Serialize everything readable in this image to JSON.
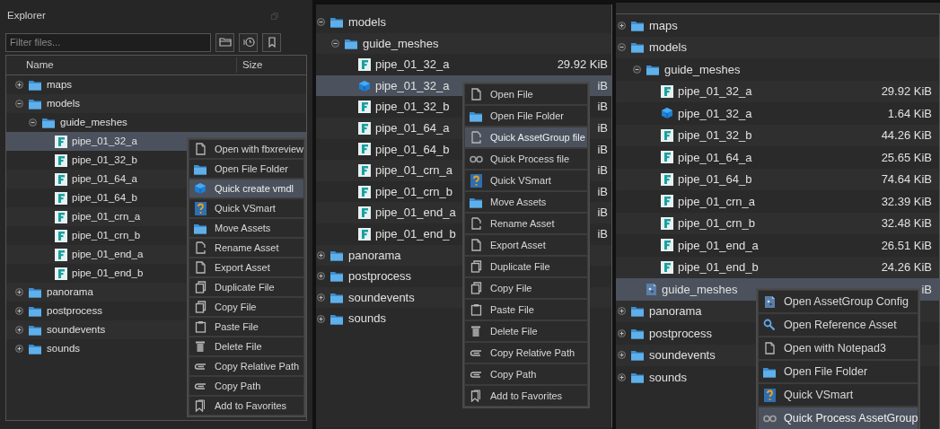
{
  "panels": [
    {
      "title": "Explorer",
      "filter": {
        "placeholder": "Filter files..."
      },
      "columns": [
        "Name",
        "Size"
      ],
      "tree": [
        {
          "name": "maps",
          "kind": "folder",
          "expanded": false,
          "selected": false
        },
        {
          "name": "models",
          "kind": "folder",
          "expanded": true,
          "selected": false,
          "children": [
            {
              "name": "guide_meshes",
              "kind": "folder",
              "expanded": true,
              "selected": false,
              "children": [
                {
                  "name": "pipe_01_32_a",
                  "kind": "fbx",
                  "selected": true
                },
                {
                  "name": "pipe_01_32_b",
                  "kind": "fbx",
                  "selected": false
                },
                {
                  "name": "pipe_01_64_a",
                  "kind": "fbx",
                  "selected": false
                },
                {
                  "name": "pipe_01_64_b",
                  "kind": "fbx",
                  "selected": false
                },
                {
                  "name": "pipe_01_crn_a",
                  "kind": "fbx",
                  "selected": false
                },
                {
                  "name": "pipe_01_crn_b",
                  "kind": "fbx",
                  "selected": false
                },
                {
                  "name": "pipe_01_end_a",
                  "kind": "fbx",
                  "selected": false
                },
                {
                  "name": "pipe_01_end_b",
                  "kind": "fbx",
                  "selected": false
                }
              ]
            }
          ]
        },
        {
          "name": "panorama",
          "kind": "folder",
          "expanded": false,
          "selected": false
        },
        {
          "name": "postprocess",
          "kind": "folder",
          "expanded": false,
          "selected": false
        },
        {
          "name": "soundevents",
          "kind": "folder",
          "expanded": false,
          "selected": false
        },
        {
          "name": "sounds",
          "kind": "folder",
          "expanded": false,
          "selected": false
        }
      ],
      "menu": [
        {
          "label": "Open with fbxreview",
          "kind": "file",
          "selected": false
        },
        {
          "label": "Open File Folder",
          "kind": "folder",
          "selected": false
        },
        {
          "label": "Quick create vmdl",
          "kind": "cube",
          "selected": true
        },
        {
          "label": "Quick VSmart",
          "kind": "vsmart",
          "selected": false
        },
        {
          "label": "Move Assets",
          "kind": "folder",
          "selected": false
        },
        {
          "label": "Rename Asset",
          "kind": "rename",
          "selected": false
        },
        {
          "label": "Export Asset",
          "kind": "file",
          "selected": false
        },
        {
          "label": "Duplicate File",
          "kind": "copy",
          "selected": false
        },
        {
          "label": "Copy File",
          "kind": "copy",
          "selected": false
        },
        {
          "label": "Paste File",
          "kind": "paste",
          "selected": false
        },
        {
          "label": "Delete File",
          "kind": "delete",
          "selected": false
        },
        {
          "label": "Copy Relative Path",
          "kind": "clip",
          "selected": false
        },
        {
          "label": "Copy Path",
          "kind": "clip",
          "selected": false
        },
        {
          "label": "Add to Favorites",
          "kind": "bookmark",
          "selected": false
        }
      ]
    },
    {
      "tree": [
        {
          "name": "models",
          "kind": "folder",
          "expanded": true,
          "selected": false,
          "children": [
            {
              "name": "guide_meshes",
              "kind": "folder",
              "expanded": true,
              "selected": false,
              "children": [
                {
                  "name": "pipe_01_32_a",
                  "kind": "fbx",
                  "selected": false,
                  "size": "29.92 KiB"
                },
                {
                  "name": "pipe_01_32_a",
                  "kind": "cube",
                  "selected": true,
                  "size": "iB"
                },
                {
                  "name": "pipe_01_32_b",
                  "kind": "fbx",
                  "selected": false,
                  "size": "iB"
                },
                {
                  "name": "pipe_01_64_a",
                  "kind": "fbx",
                  "selected": false,
                  "size": "iB"
                },
                {
                  "name": "pipe_01_64_b",
                  "kind": "fbx",
                  "selected": false,
                  "size": "iB"
                },
                {
                  "name": "pipe_01_crn_a",
                  "kind": "fbx",
                  "selected": false,
                  "size": "iB"
                },
                {
                  "name": "pipe_01_crn_b",
                  "kind": "fbx",
                  "selected": false,
                  "size": "iB"
                },
                {
                  "name": "pipe_01_end_a",
                  "kind": "fbx",
                  "selected": false,
                  "size": "iB"
                },
                {
                  "name": "pipe_01_end_b",
                  "kind": "fbx",
                  "selected": false,
                  "size": "iB"
                }
              ]
            }
          ]
        },
        {
          "name": "panorama",
          "kind": "folder",
          "expanded": false,
          "selected": false
        },
        {
          "name": "postprocess",
          "kind": "folder",
          "expanded": false,
          "selected": false
        },
        {
          "name": "soundevents",
          "kind": "folder",
          "expanded": false,
          "selected": false
        },
        {
          "name": "sounds",
          "kind": "folder",
          "expanded": false,
          "selected": false
        }
      ],
      "menu": [
        {
          "label": "Open File",
          "kind": "file",
          "selected": false
        },
        {
          "label": "Open File Folder",
          "kind": "folder",
          "selected": false
        },
        {
          "label": "Quick AssetGroup file",
          "kind": "rename",
          "selected": true
        },
        {
          "label": "Quick Process file",
          "kind": "process",
          "selected": false
        },
        {
          "label": "Quick VSmart",
          "kind": "vsmart",
          "selected": false
        },
        {
          "label": "Move Assets",
          "kind": "folder",
          "selected": false
        },
        {
          "label": "Rename Asset",
          "kind": "rename",
          "selected": false
        },
        {
          "label": "Export Asset",
          "kind": "file",
          "selected": false
        },
        {
          "label": "Duplicate File",
          "kind": "copy",
          "selected": false
        },
        {
          "label": "Copy File",
          "kind": "copy",
          "selected": false
        },
        {
          "label": "Paste File",
          "kind": "paste",
          "selected": false
        },
        {
          "label": "Delete File",
          "kind": "delete",
          "selected": false
        },
        {
          "label": "Copy Relative Path",
          "kind": "clip",
          "selected": false
        },
        {
          "label": "Copy Path",
          "kind": "clip",
          "selected": false
        },
        {
          "label": "Add to Favorites",
          "kind": "bookmark",
          "selected": false
        }
      ]
    },
    {
      "tree": [
        {
          "name": "maps",
          "kind": "folder",
          "expanded": false,
          "selected": false
        },
        {
          "name": "models",
          "kind": "folder",
          "expanded": true,
          "selected": false,
          "children": [
            {
              "name": "guide_meshes",
              "kind": "folder",
              "expanded": true,
              "selected": false,
              "children": [
                {
                  "name": "pipe_01_32_a",
                  "kind": "fbx",
                  "selected": false,
                  "size": "29.92 KiB"
                },
                {
                  "name": "pipe_01_32_a",
                  "kind": "cube",
                  "selected": false,
                  "size": "1.64 KiB"
                },
                {
                  "name": "pipe_01_32_b",
                  "kind": "fbx",
                  "selected": false,
                  "size": "44.26 KiB"
                },
                {
                  "name": "pipe_01_64_a",
                  "kind": "fbx",
                  "selected": false,
                  "size": "25.65 KiB"
                },
                {
                  "name": "pipe_01_64_b",
                  "kind": "fbx",
                  "selected": false,
                  "size": "74.64 KiB"
                },
                {
                  "name": "pipe_01_crn_a",
                  "kind": "fbx",
                  "selected": false,
                  "size": "32.39 KiB"
                },
                {
                  "name": "pipe_01_crn_b",
                  "kind": "fbx",
                  "selected": false,
                  "size": "32.48 KiB"
                },
                {
                  "name": "pipe_01_end_a",
                  "kind": "fbx",
                  "selected": false,
                  "size": "26.51 KiB"
                },
                {
                  "name": "pipe_01_end_b",
                  "kind": "fbx",
                  "selected": false,
                  "size": "24.26 KiB"
                }
              ]
            },
            {
              "name": "guide_meshes",
              "kind": "assetgroup",
              "selected": true,
              "size": "iB"
            }
          ]
        },
        {
          "name": "panorama",
          "kind": "folder",
          "expanded": false,
          "selected": false
        },
        {
          "name": "postprocess",
          "kind": "folder",
          "expanded": false,
          "selected": false
        },
        {
          "name": "soundevents",
          "kind": "folder",
          "expanded": false,
          "selected": false
        },
        {
          "name": "sounds",
          "kind": "folder",
          "expanded": false,
          "selected": false
        }
      ],
      "menu": [
        {
          "label": "Open AssetGroup Config",
          "kind": "assetgroup",
          "selected": false
        },
        {
          "label": "Open Reference Asset",
          "kind": "search",
          "selected": false
        },
        {
          "label": "Open with Notepad3",
          "kind": "file",
          "selected": false
        },
        {
          "label": "Open File Folder",
          "kind": "folder",
          "selected": false
        },
        {
          "label": "Quick VSmart",
          "kind": "vsmart",
          "selected": false
        },
        {
          "label": "Quick Process AssetGroup",
          "kind": "process",
          "selected": true
        }
      ]
    }
  ]
}
